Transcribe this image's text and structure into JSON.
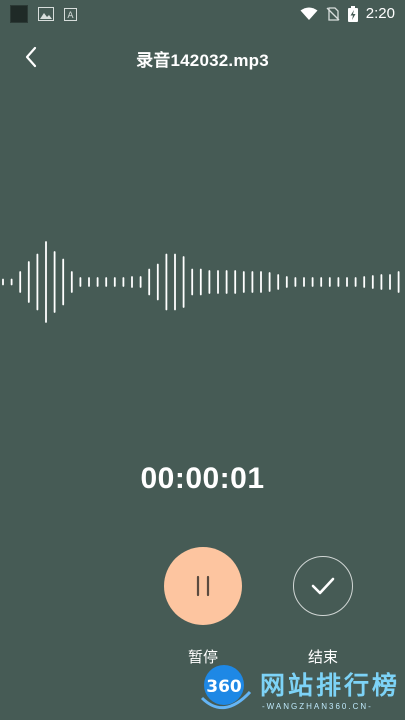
{
  "status_bar": {
    "time": "2:20"
  },
  "header": {
    "title": "录音142032.mp3"
  },
  "timer": {
    "elapsed": "00:00:01"
  },
  "controls": {
    "pause_label": "暂停",
    "finish_label": "结束"
  },
  "waveform": {
    "amplitudes": [
      0.05,
      0.05,
      0.2,
      0.4,
      0.55,
      0.8,
      0.6,
      0.45,
      0.2,
      0.08,
      0.08,
      0.08,
      0.08,
      0.08,
      0.08,
      0.1,
      0.1,
      0.25,
      0.35,
      0.55,
      0.55,
      0.5,
      0.25,
      0.25,
      0.22,
      0.22,
      0.22,
      0.22,
      0.2,
      0.2,
      0.2,
      0.18,
      0.14,
      0.1,
      0.08,
      0.08,
      0.08,
      0.08,
      0.08,
      0.08,
      0.08,
      0.08,
      0.1,
      0.12,
      0.14,
      0.14,
      0.2
    ]
  },
  "watermark": {
    "text": "网站排行榜",
    "badge": "360",
    "subtext": "-WANGZHAN360.CN-"
  },
  "colors": {
    "background": "#465B55",
    "accent": "#FDC5A0",
    "text": "#FFFFFF"
  }
}
